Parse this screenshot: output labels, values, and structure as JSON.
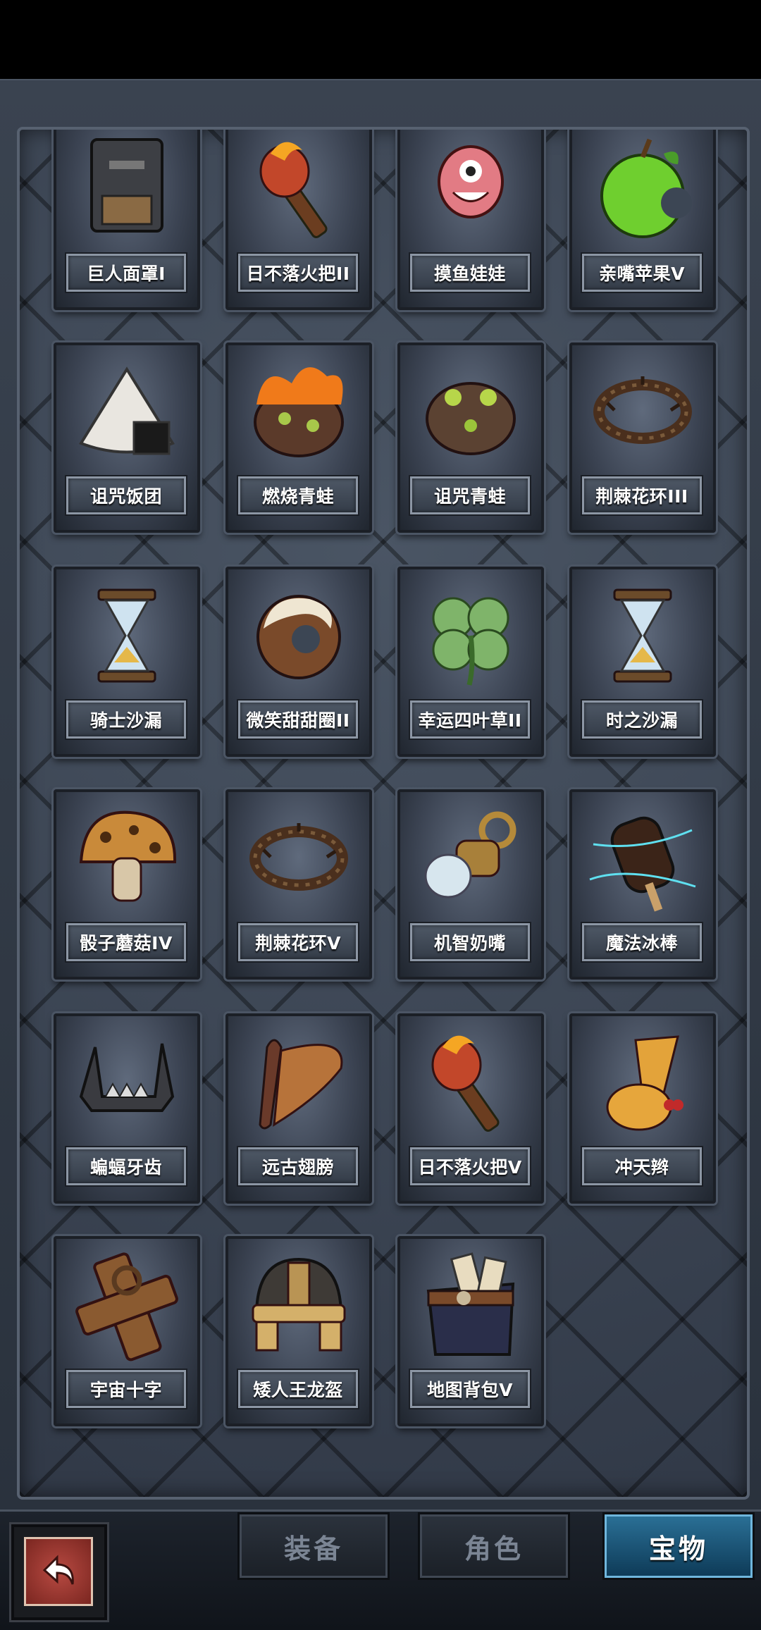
{
  "items": [
    {
      "name": "巨人面罩I",
      "icon": "giant-mask-icon"
    },
    {
      "name": "日不落火把II",
      "icon": "torch-icon"
    },
    {
      "name": "摸鱼娃娃",
      "icon": "doll-icon"
    },
    {
      "name": "亲嘴苹果V",
      "icon": "apple-icon"
    },
    {
      "name": "诅咒饭团",
      "icon": "rice-ball-icon"
    },
    {
      "name": "燃烧青蛙",
      "icon": "burning-frog-icon"
    },
    {
      "name": "诅咒青蛙",
      "icon": "cursed-frog-icon"
    },
    {
      "name": "荆棘花环III",
      "icon": "thorn-wreath-icon"
    },
    {
      "name": "骑士沙漏",
      "icon": "hourglass-icon"
    },
    {
      "name": "微笑甜甜圈II",
      "icon": "donut-icon"
    },
    {
      "name": "幸运四叶草II",
      "icon": "clover-icon"
    },
    {
      "name": "时之沙漏",
      "icon": "hourglass-icon"
    },
    {
      "name": "骰子蘑菇IV",
      "icon": "mushroom-icon"
    },
    {
      "name": "荆棘花环V",
      "icon": "thorn-wreath-icon"
    },
    {
      "name": "机智奶嘴",
      "icon": "pacifier-icon"
    },
    {
      "name": "魔法冰棒",
      "icon": "popsicle-icon"
    },
    {
      "name": "蝙蝠牙齿",
      "icon": "bat-teeth-icon"
    },
    {
      "name": "远古翅膀",
      "icon": "wing-icon"
    },
    {
      "name": "日不落火把V",
      "icon": "torch-icon"
    },
    {
      "name": "冲天辫",
      "icon": "pigtail-icon"
    },
    {
      "name": "宇宙十字",
      "icon": "cross-icon"
    },
    {
      "name": "矮人王龙盔",
      "icon": "helmet-icon"
    },
    {
      "name": "地图背包V",
      "icon": "map-bag-icon"
    }
  ],
  "tabs": [
    {
      "label": "装备",
      "active": false
    },
    {
      "label": "角色",
      "active": false
    },
    {
      "label": "宝物",
      "active": true
    }
  ],
  "back_button": {
    "icon": "back-arrow-icon"
  }
}
